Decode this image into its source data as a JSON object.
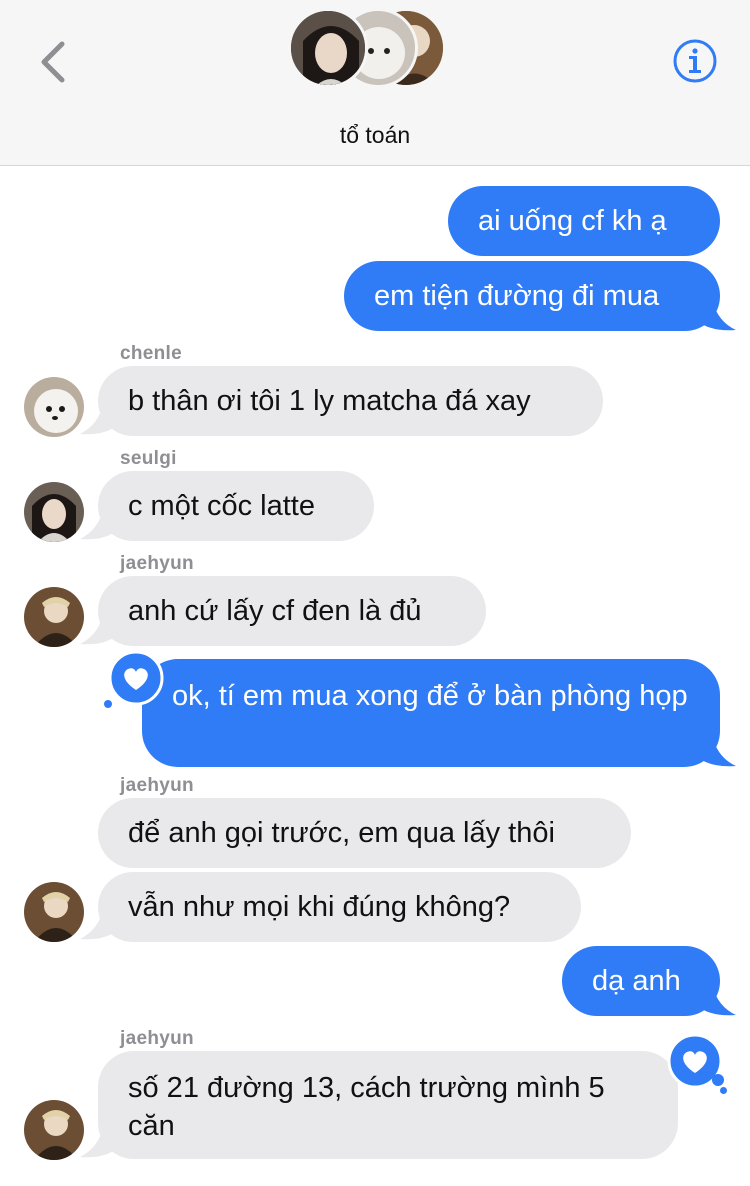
{
  "header": {
    "group_name": "tổ toán",
    "back_icon": "chevron-left-icon",
    "info_icon": "info-icon",
    "accent": "#2f7cf6"
  },
  "messages": [
    {
      "dir": "out",
      "text": "ai uống cf kh ạ"
    },
    {
      "dir": "out",
      "text": "em tiện đường đi mua"
    },
    {
      "dir": "in",
      "sender": "chenle",
      "text": "b thân ơi tôi 1 ly matcha đá xay"
    },
    {
      "dir": "in",
      "sender": "seulgi",
      "text": "c một cốc latte"
    },
    {
      "dir": "in",
      "sender": "jaehyun",
      "text": "anh cứ lấy cf đen là đủ"
    },
    {
      "dir": "out",
      "text": "ok, tí em mua xong để ở bàn phòng họp",
      "reaction": "heart-icon"
    },
    {
      "dir": "in",
      "sender": "jaehyun",
      "text": "để anh gọi trước, em qua lấy thôi"
    },
    {
      "dir": "in",
      "text": "vẫn như mọi khi đúng không?"
    },
    {
      "dir": "out",
      "text": "dạ anh"
    },
    {
      "dir": "in",
      "sender": "jaehyun",
      "text": "số 21 đường 13, cách trường mình 5 căn",
      "reaction": "heart-icon"
    }
  ],
  "colors": {
    "outgoing_bubble": "#2f7cf6",
    "incoming_bubble": "#e9e9eb",
    "sender_label": "#8e8e93"
  }
}
